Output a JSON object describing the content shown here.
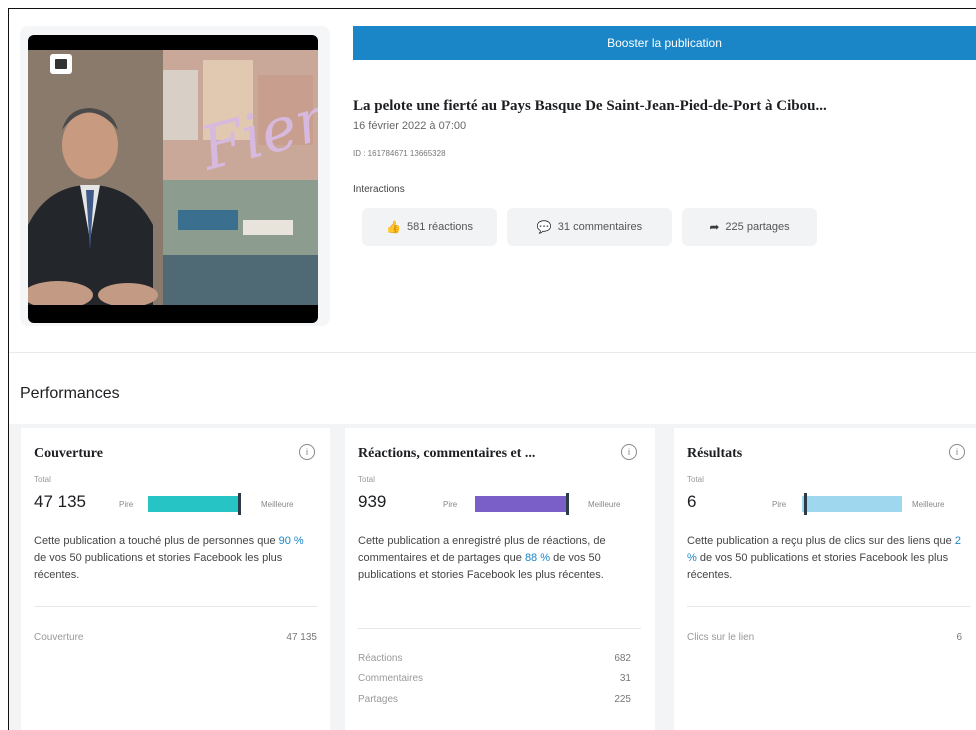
{
  "post": {
    "boost_label": "Booster la publication",
    "title": "La pelote une fierté au Pays Basque De Saint-Jean-Pied-de-Port à Cibou...",
    "date": "16 février 2022 à 07:00",
    "id": "ID : 161784671 13665328",
    "interactions_label": "Interactions",
    "reactions": "581 réactions",
    "comments": "31 commentaires",
    "shares": "225 partages"
  },
  "performances": {
    "title": "Performances",
    "cards": [
      {
        "title": "Couverture",
        "total_label": "Total",
        "total": "47 135",
        "low": "Pire",
        "high": "Meilleure",
        "level": 0.9,
        "bar_color": "#27c4c6",
        "desc_before": "Cette publication a touché plus de personnes que ",
        "pct": "90 %",
        "desc_after": " de vos 50 publications et stories Facebook les plus récentes.",
        "rows": [
          {
            "label": "Couverture",
            "value": "47 135"
          }
        ]
      },
      {
        "title": "Réactions, commentaires et ...",
        "total_label": "Total",
        "total": "939",
        "low": "Pire",
        "high": "Meilleure",
        "level": 0.88,
        "bar_color": "#7b5fc8",
        "desc_before": "Cette publication a enregistré plus de réactions, de commentaires et de partages que ",
        "pct": "88 %",
        "desc_after": " de vos 50 publications et stories Facebook les plus récentes.",
        "rows": [
          {
            "label": "Réactions",
            "value": "682"
          },
          {
            "label": "Commentaires",
            "value": "31"
          },
          {
            "label": "Partages",
            "value": "225"
          }
        ]
      },
      {
        "title": "Résultats",
        "total_label": "Total",
        "total": "6",
        "low": "Pire",
        "high": "Meilleure",
        "level": 0.02,
        "bar_color": "#9fd7ef",
        "desc_before": "Cette publication a reçu plus de clics sur des liens que ",
        "pct": "2 %",
        "desc_after": " de vos 50 publications et stories Facebook les plus récentes.",
        "rows": [
          {
            "label": "Clics sur le lien",
            "value": "6"
          }
        ]
      }
    ]
  },
  "colors": {
    "accent": "#1a86c8",
    "pct_text": "#1a86c8"
  }
}
